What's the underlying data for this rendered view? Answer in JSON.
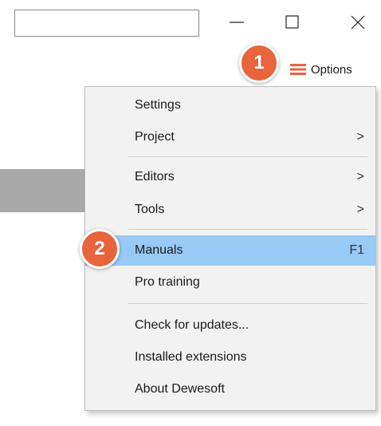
{
  "window": {
    "search_value": "",
    "controls": [
      {
        "icon": "minimize-icon"
      },
      {
        "icon": "maximize-icon"
      },
      {
        "icon": "close-icon"
      }
    ]
  },
  "options_button": {
    "icon": "hamburger-icon",
    "label": "Options",
    "icon_color": "#e8643c"
  },
  "step_badges": [
    "1",
    "2"
  ],
  "menu": {
    "highlight_color": "#99c9f5",
    "groups": [
      [
        {
          "label": "Settings",
          "right": ""
        },
        {
          "label": "Project",
          "right": ">"
        }
      ],
      [
        {
          "label": "Editors",
          "right": ">"
        },
        {
          "label": "Tools",
          "right": ">"
        }
      ],
      [
        {
          "label": "Manuals",
          "right": "F1",
          "highlighted": true
        },
        {
          "label": "Pro training",
          "right": ""
        }
      ],
      [
        {
          "label": "Check for updates...",
          "right": ""
        },
        {
          "label": "Installed extensions",
          "right": ""
        },
        {
          "label": "About Dewesoft",
          "right": ""
        }
      ]
    ]
  },
  "colors": {
    "badge": "#e8643c",
    "gray_strip": "#a9a9a9",
    "menu_bg": "#f2f2f2"
  }
}
